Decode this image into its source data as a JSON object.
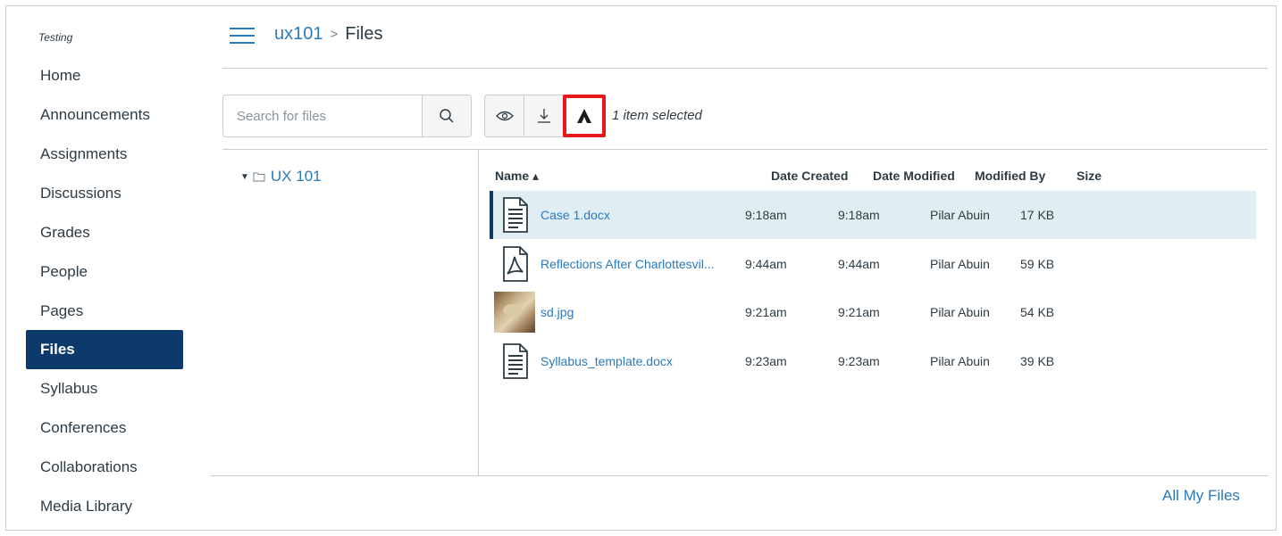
{
  "course": {
    "label": "Testing"
  },
  "sidebar": {
    "items": [
      {
        "label": "Home"
      },
      {
        "label": "Announcements"
      },
      {
        "label": "Assignments"
      },
      {
        "label": "Discussions"
      },
      {
        "label": "Grades"
      },
      {
        "label": "People"
      },
      {
        "label": "Pages"
      },
      {
        "label": "Files",
        "active": true
      },
      {
        "label": "Syllabus"
      },
      {
        "label": "Conferences"
      },
      {
        "label": "Collaborations"
      },
      {
        "label": "Media Library"
      }
    ]
  },
  "header": {
    "breadcrumb": {
      "course": "ux101",
      "separator": ">",
      "current": "Files"
    },
    "menu_icon": "hamburger-icon"
  },
  "toolbar": {
    "search_placeholder": "Search for files",
    "search_icon": "search-icon",
    "preview_icon": "eye-icon",
    "download_icon": "download-icon",
    "accessibility_icon": "ally-icon",
    "selected_text": "1 item selected"
  },
  "tree": {
    "folder": "UX 101",
    "toggle": "▼"
  },
  "table": {
    "columns": {
      "name": "Name ▴",
      "date_created": "Date Created",
      "date_modified": "Date Modified",
      "modified_by": "Modified By",
      "size": "Size"
    },
    "rows": [
      {
        "name": "Case 1.docx",
        "icon": "document-icon",
        "created": "9:18am",
        "modified": "9:18am",
        "by": "Pilar Abuin",
        "size": "17 KB",
        "selected": true
      },
      {
        "name": "Reflections After Charlottesvil...",
        "icon": "pdf-icon",
        "created": "9:44am",
        "modified": "9:44am",
        "by": "Pilar Abuin",
        "size": "59 KB"
      },
      {
        "name": "sd.jpg",
        "icon": "image-thumbnail",
        "created": "9:21am",
        "modified": "9:21am",
        "by": "Pilar Abuin",
        "size": "54 KB"
      },
      {
        "name": "Syllabus_template.docx",
        "icon": "document-icon",
        "created": "9:23am",
        "modified": "9:23am",
        "by": "Pilar Abuin",
        "size": "39 KB"
      }
    ]
  },
  "footer": {
    "all_files": "All My Files"
  },
  "colors": {
    "accent": "#2b7abc",
    "active_nav": "#0b3a6b",
    "selected_row": "#e0eef4",
    "highlight": "#e8171b"
  }
}
